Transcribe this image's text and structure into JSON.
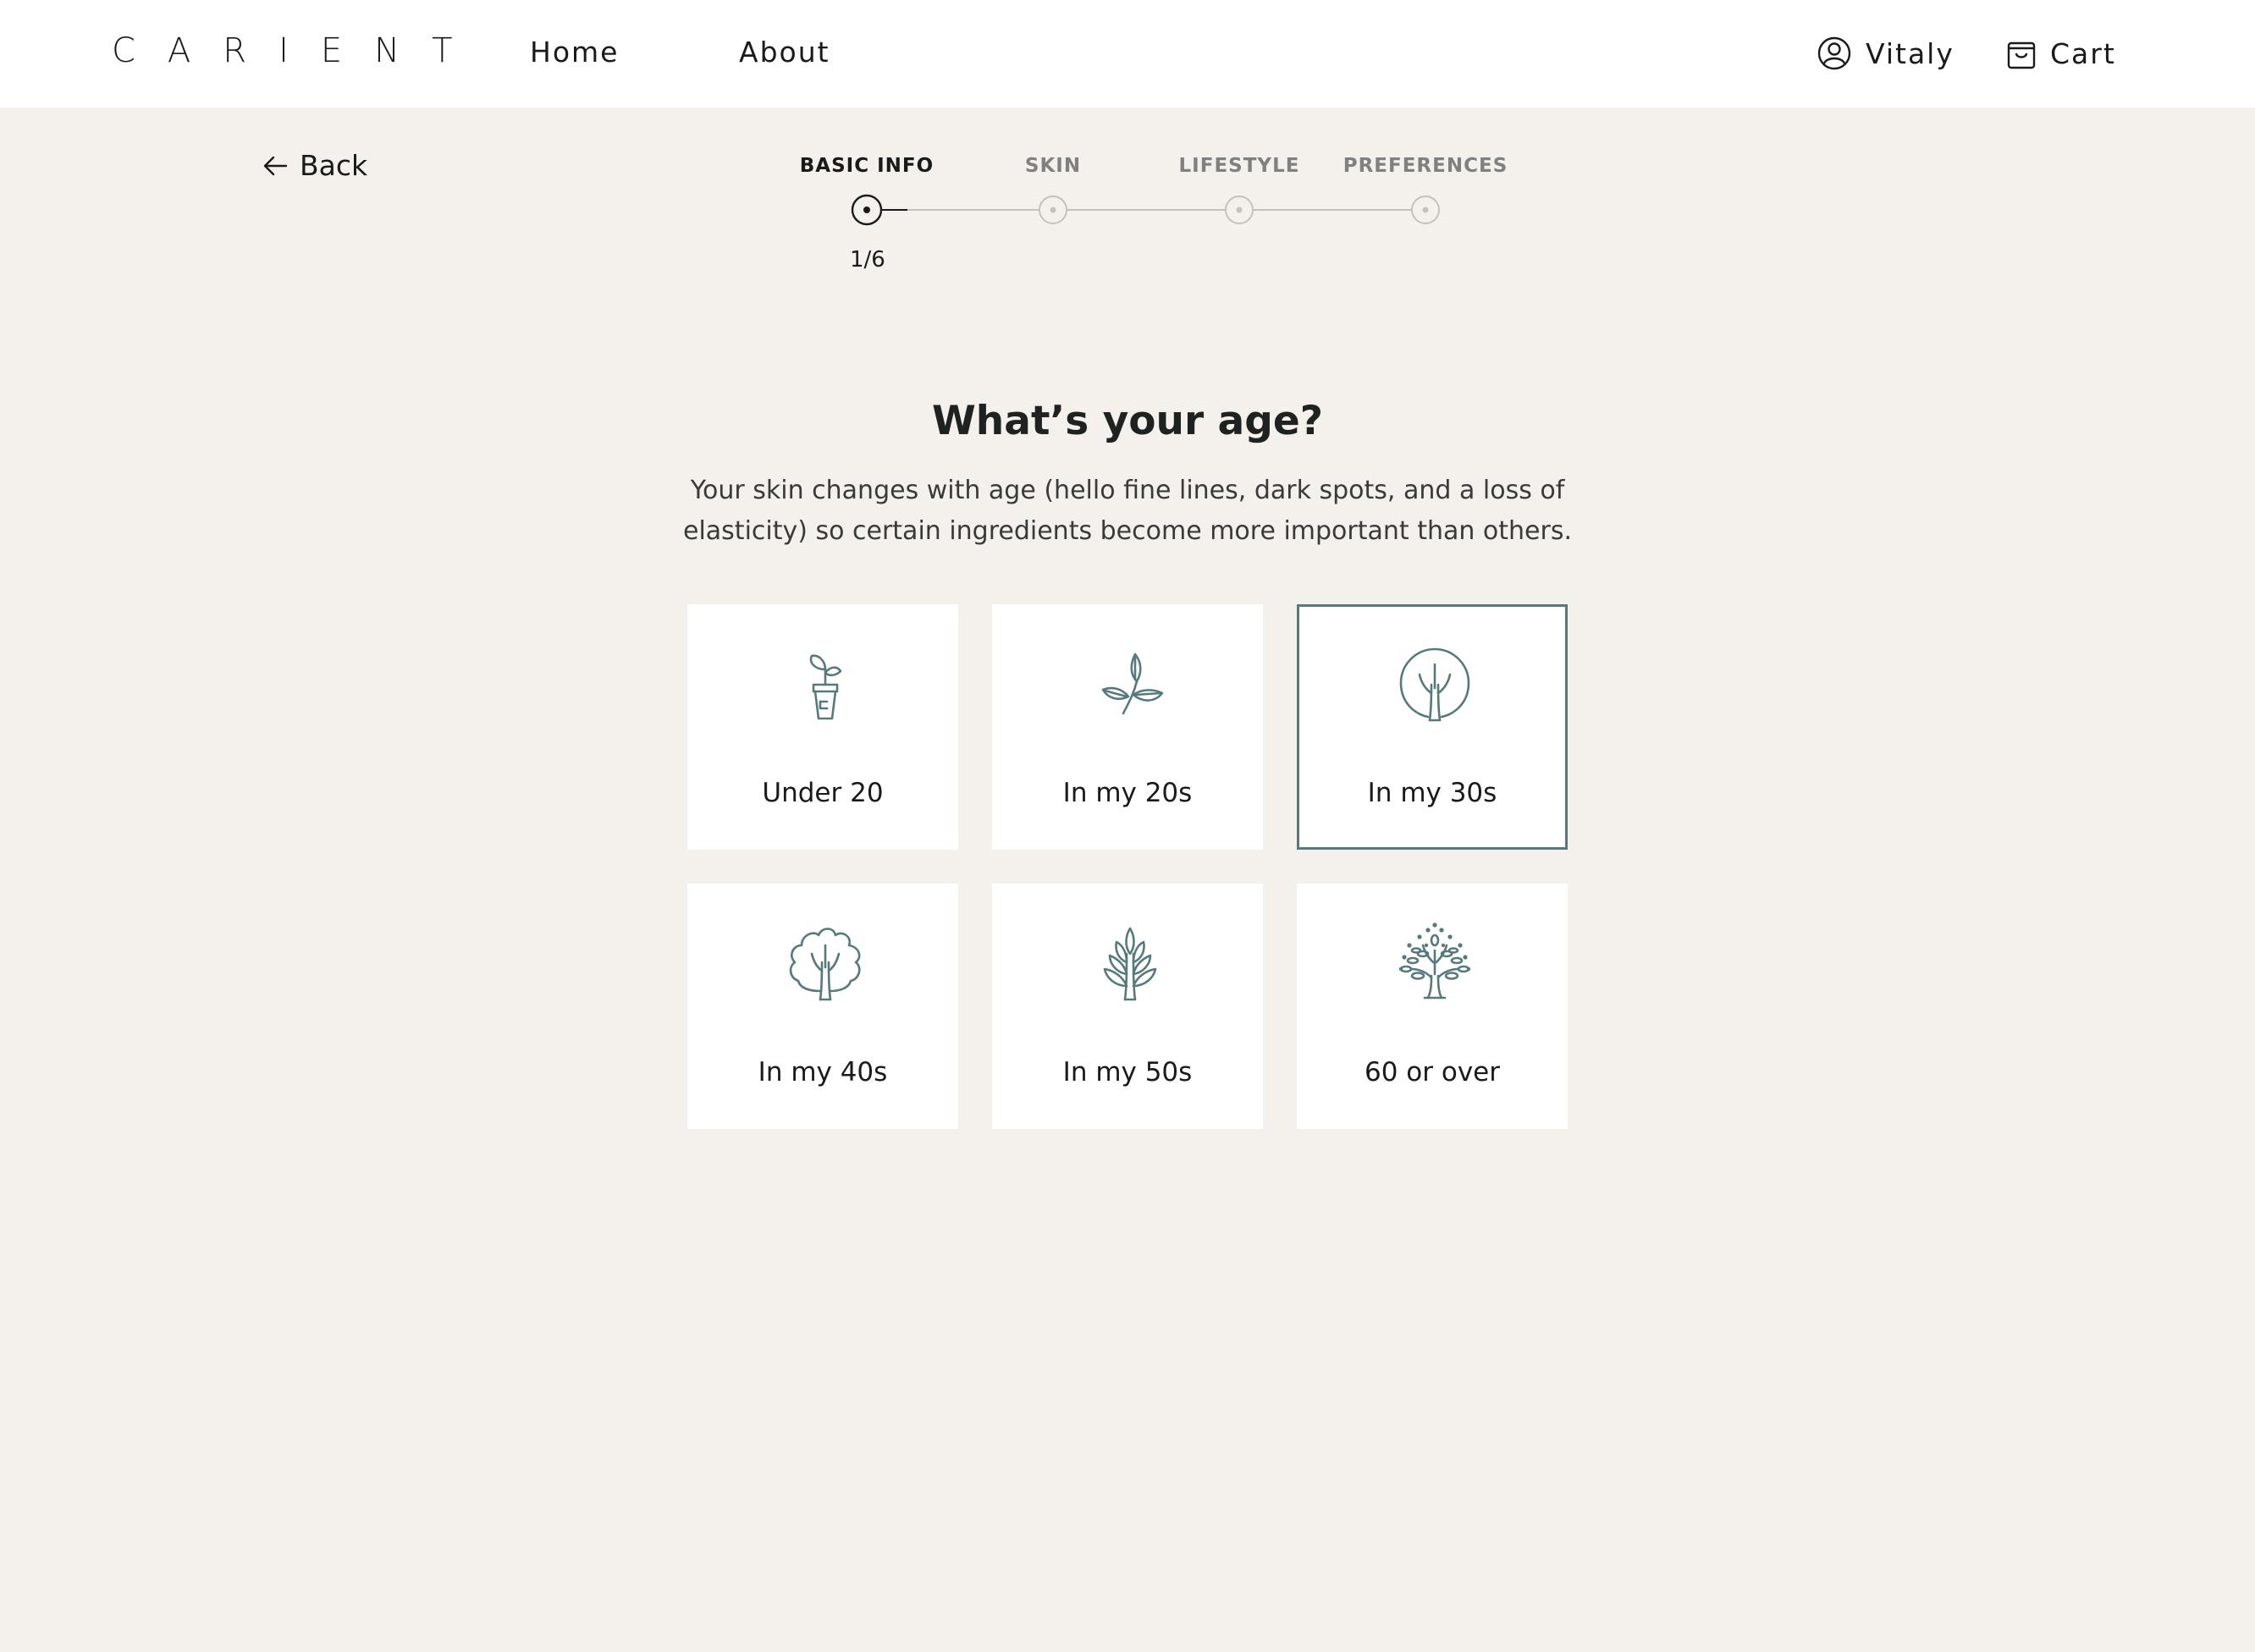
{
  "header": {
    "logo": "CARIENT",
    "nav": {
      "home": "Home",
      "about": "About"
    },
    "account_label": "Vitaly",
    "cart_label": "Cart"
  },
  "back_label": "Back",
  "stepper": {
    "steps": [
      "BASIC INFO",
      "SKIN",
      "LIFESTYLE",
      "PREFERENCES"
    ],
    "active_step": 0,
    "counter": "1/6"
  },
  "question": {
    "title": "What’s your age?",
    "description": "Your skin changes with age (hello fine lines, dark spots, and a loss of elasticity) so certain ingredients become more important than others."
  },
  "options": [
    {
      "label": "Under 20",
      "icon": "potted-sprout-icon",
      "selected": false
    },
    {
      "label": "In my 20s",
      "icon": "sprouting-branch-icon",
      "selected": false
    },
    {
      "label": "In my 30s",
      "icon": "round-tree-icon",
      "selected": true
    },
    {
      "label": "In my 40s",
      "icon": "oak-tree-icon",
      "selected": false
    },
    {
      "label": "In my 50s",
      "icon": "leafy-tree-icon",
      "selected": false
    },
    {
      "label": "60 or over",
      "icon": "mature-tree-icon",
      "selected": false
    }
  ],
  "colors": {
    "background": "#f4f1ec",
    "accent": "#567a7c",
    "card": "#ffffff",
    "text": "#1a1a1a"
  }
}
